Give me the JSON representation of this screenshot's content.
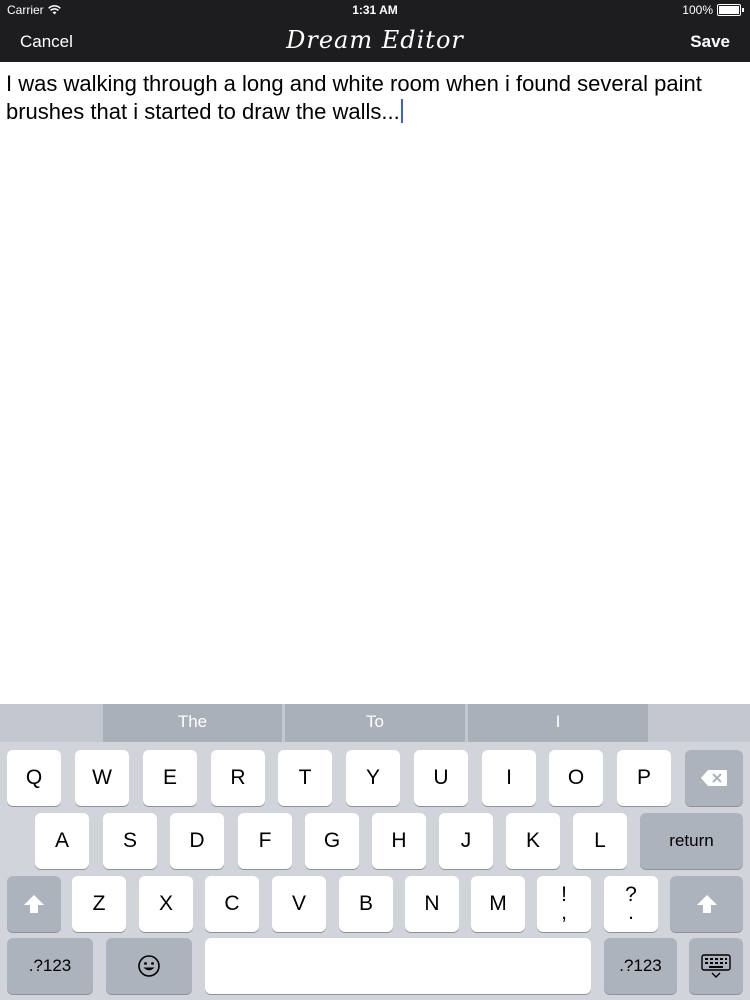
{
  "status": {
    "carrier": "Carrier",
    "time": "1:31 AM",
    "battery": "100%"
  },
  "nav": {
    "cancel": "Cancel",
    "title": "Dream Editor",
    "save": "Save"
  },
  "editor": {
    "text": "I was walking through a long and white room when i found several paint brushes that i started to draw the walls..."
  },
  "keyboard": {
    "suggestions": [
      "The",
      "To",
      "I"
    ],
    "row1": [
      "Q",
      "W",
      "E",
      "R",
      "T",
      "Y",
      "U",
      "I",
      "O",
      "P"
    ],
    "row2": [
      "A",
      "S",
      "D",
      "F",
      "G",
      "H",
      "J",
      "K",
      "L"
    ],
    "return": "return",
    "row3": [
      "Z",
      "X",
      "C",
      "V",
      "B",
      "N",
      "M"
    ],
    "punct1_top": "!",
    "punct1_bottom": ",",
    "punct2_top": "?",
    "punct2_bottom": ".",
    "numbers": ".?123",
    "icons": {
      "delete": "delete-icon",
      "shift": "shift-icon",
      "emoji": "emoji-icon",
      "dismiss": "keyboard-dismiss-icon",
      "wifi": "wifi-icon",
      "battery": "battery-icon"
    }
  }
}
